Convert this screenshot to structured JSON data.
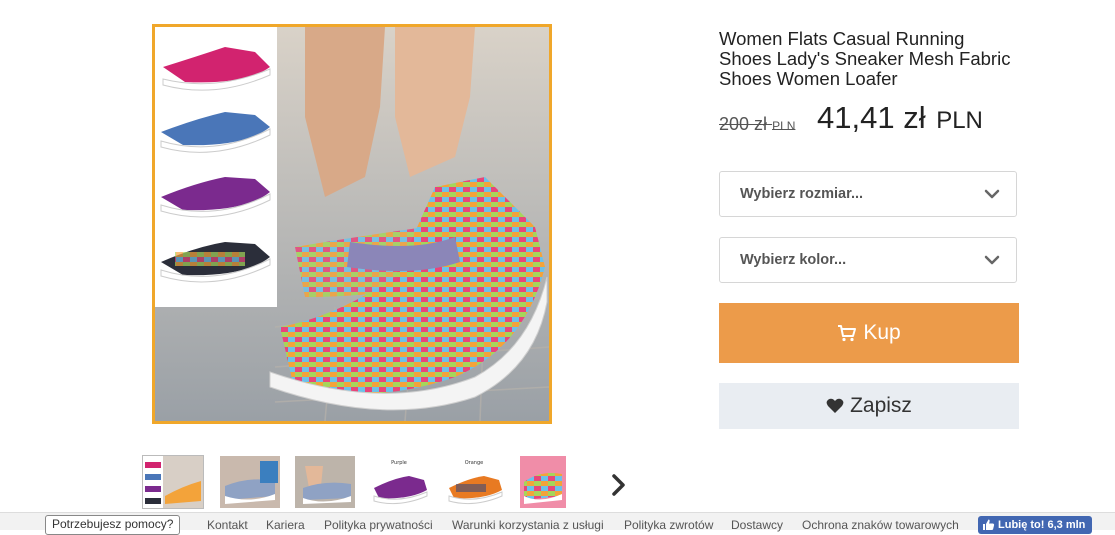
{
  "product": {
    "title": "Women Flats Casual Running Shoes Lady's Sneaker Mesh Fabric Shoes Women Loafer",
    "price_old": "200 zł",
    "price_old_currency": "PLN",
    "price_new": "41,41 zł",
    "price_new_currency": "PLN"
  },
  "options": {
    "size_placeholder": "Wybierz rozmiar...",
    "color_placeholder": "Wybierz kolor..."
  },
  "actions": {
    "buy_label": "Kup",
    "save_label": "Zapisz"
  },
  "thumbnails": {
    "captions": [
      "",
      "",
      "",
      "Purple",
      "Orange",
      ""
    ]
  },
  "footer": {
    "help": "Potrzebujesz pomocy?",
    "links": [
      "Kontakt",
      "Kariera",
      "Polityka prywatności",
      "Warunki korzystania z usługi",
      "Polityka zwrotów",
      "Dostawcy",
      "Ochrona znaków towarowych"
    ],
    "fb_like": "Lubię to! 6,3 mln"
  },
  "colors": {
    "accent_orange": "#ec9b4a",
    "image_border": "#f0a72a",
    "save_bg": "#e9edf2",
    "facebook_blue": "#4267b2"
  }
}
